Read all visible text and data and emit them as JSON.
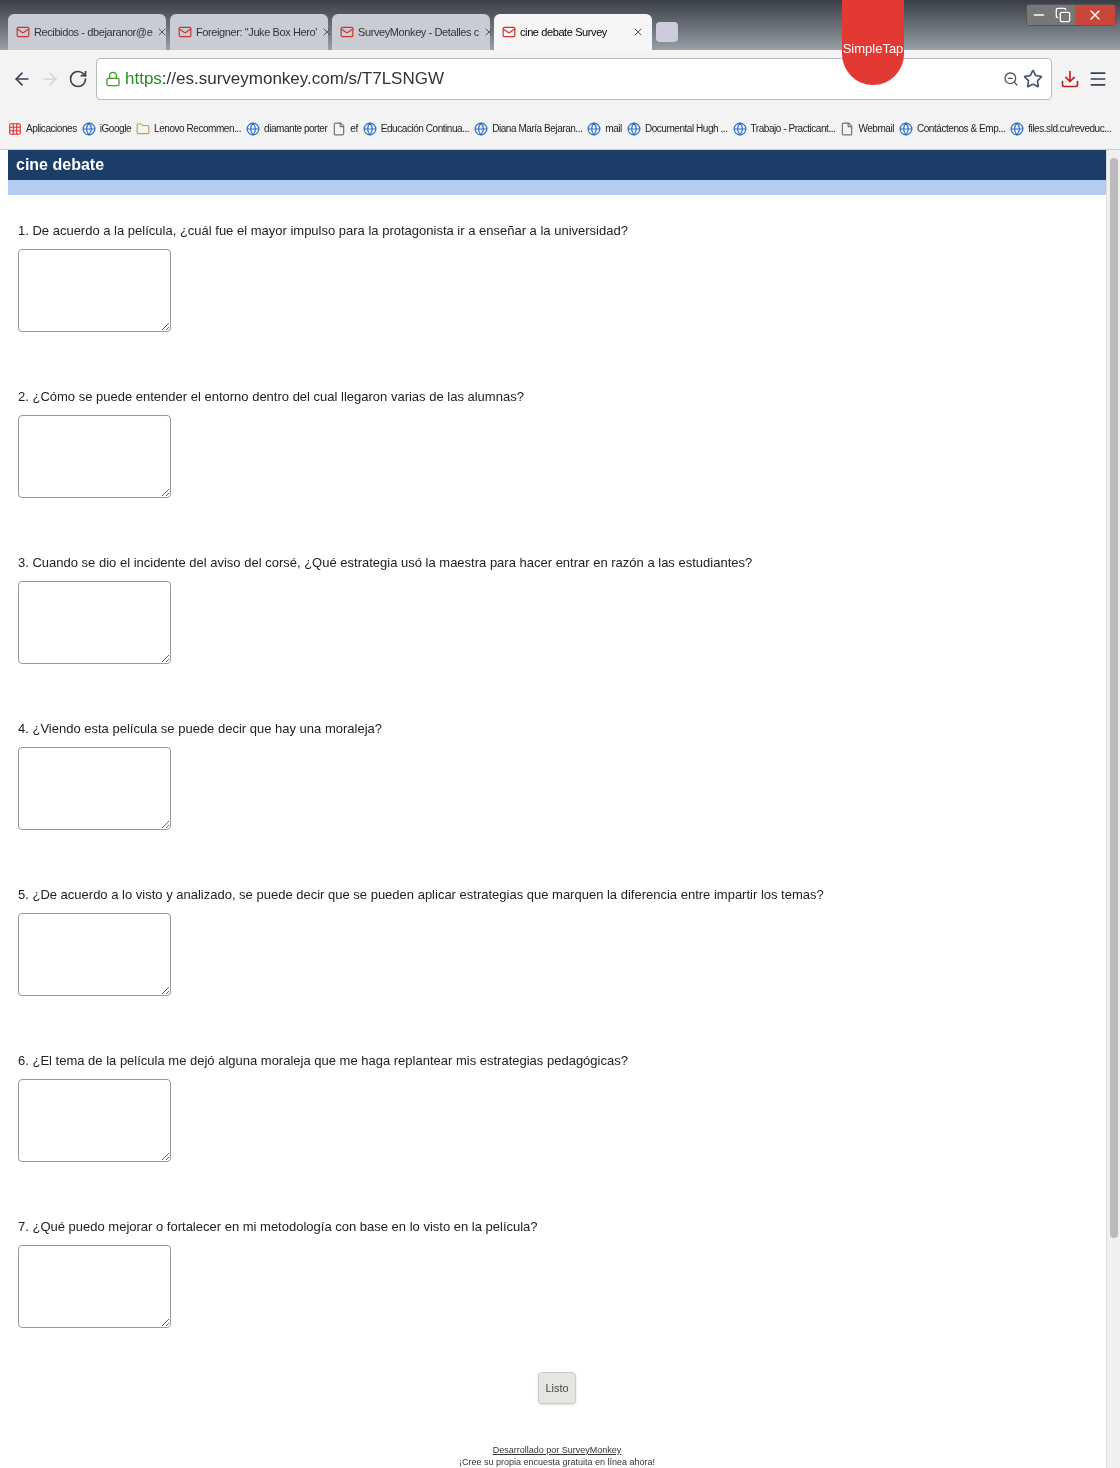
{
  "browser": {
    "tabs": [
      {
        "title": "Recibidos - dbejaranor@e",
        "selected": false
      },
      {
        "title": "Foreigner: \"Juke Box Hero'",
        "selected": false
      },
      {
        "title": "SurveyMonkey - Detalles c",
        "selected": false
      },
      {
        "title": "cine debate Survey",
        "selected": true
      }
    ],
    "overlay_badge": "SimpleTap",
    "url": {
      "scheme": "https",
      "rest": "://es.surveymonkey.com/s/T7LSNGW"
    },
    "bookmarks": [
      "Aplicaciones",
      "iGoogle",
      "Lenovo Recommen...",
      "diamante porter",
      "ef",
      "Educación Continua...",
      "Diana María Bejaran...",
      "mail",
      "Documental Hugh ...",
      "Trabajo - Practicant...",
      "Webmail",
      "Contáctenos & Emp...",
      "files.sld.cu/reveduc..."
    ]
  },
  "survey": {
    "title": "cine debate",
    "questions": [
      "1. De acuerdo a la película, ¿cuál fue el mayor impulso para la protagonista ir a enseñar a la universidad?",
      "2. ¿Cómo se puede entender el entorno dentro del cual llegaron varias de las alumnas?",
      "3. Cuando se dio el incidente del aviso del corsé, ¿Qué estrategia usó la maestra para hacer entrar en razón a las estudiantes?",
      "4. ¿Viendo esta película se puede decir que hay una moraleja?",
      "5. ¿De acuerdo a lo visto y analizado, se puede decir que se pueden aplicar estrategias que marquen la diferencia entre impartir los temas?",
      "6. ¿El tema de la película me dejó alguna moraleja que me haga replantear mis estrategias pedagógicas?",
      "7. ¿Qué puedo mejorar o fortalecer en mi metodología con base en lo visto en la película?"
    ],
    "submit_button": "Listo",
    "footer_link": "Desarrollado por SurveyMonkey",
    "footer_text": "¡Cree su propia encuesta gratuita en línea ahora!"
  }
}
